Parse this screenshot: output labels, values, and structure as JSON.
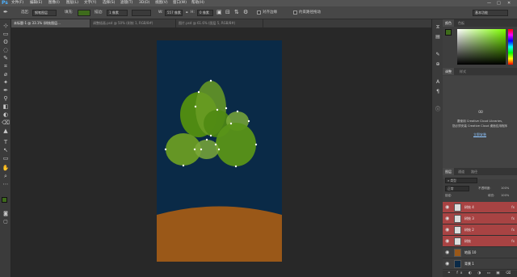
{
  "app": {
    "logo": "Ps",
    "menus": [
      "文件(F)",
      "编辑(E)",
      "图像(I)",
      "图层(L)",
      "文字(Y)",
      "选择(S)",
      "滤镜(T)",
      "3D(D)",
      "视图(V)",
      "窗口(W)",
      "帮助(H)"
    ],
    "window_controls": [
      "—",
      "□",
      "✕"
    ]
  },
  "options_bar": {
    "select_label": "选区:",
    "select_value": "钢笔图层",
    "fill_label": "填充:",
    "stroke_label": "描边:",
    "stroke_width": "1 像素",
    "w_label": "W:",
    "w_value": "557 像素",
    "h_label": "H:",
    "h_value": "0 像素",
    "align_edges_label": "对齐边缘",
    "constrain_label": "约束路径拖动",
    "workspace_value": "基本功能",
    "fill_color": "#3e6b1b"
  },
  "tabs": [
    "未标题-1 @ 33.1% (树枝图层...",
    "调整插画.psd @ 50% (树枝 1, RGB/8#)",
    "图片.psd @ 61.6% (图层 5, RGB/8#)"
  ],
  "toolbar": {
    "tools": [
      "⊹",
      "▭",
      "ʘ",
      "◌",
      "✎",
      "⌗",
      "⌀",
      "✦",
      "✒",
      "⚲",
      "◧",
      "◐",
      "⌫",
      "▲",
      "T",
      "↖",
      "▭",
      "✋",
      "⌕",
      "⋯"
    ],
    "fg_color": "#3e6b1b",
    "bg_color": "#ffffff"
  },
  "canvas": {
    "sky_color": "#0a2a47",
    "ground_color": "#9a5818",
    "leaf_color_dark": "#4f8a12",
    "leaf_color_light": "#7aa83a"
  },
  "right_panels": {
    "color_tabs": [
      "颜色",
      "色板"
    ],
    "adjust_tabs": [
      "调整",
      "样式"
    ],
    "cc_title": "库",
    "cc_text_1": "要使用 Creative Cloud Libraries,",
    "cc_text_2": "您必须安装 Creative Cloud 桌面应用程序",
    "cc_link": "立即安装",
    "layers_tabs": [
      "图层",
      "通道",
      "路径"
    ],
    "blend_mode": "正常",
    "opacity_label": "不透明度:",
    "opacity_value": "100%",
    "lock_label": "锁定:",
    "fill_label": "填充:",
    "fill_value": "100%",
    "layers": [
      {
        "name": "树枝 4",
        "fx": "fx"
      },
      {
        "name": "树枝 3",
        "fx": "fx"
      },
      {
        "name": "树枝 2",
        "fx": "fx"
      },
      {
        "name": "树枝",
        "fx": "fx"
      },
      {
        "name": "地面 10",
        "fx": ""
      },
      {
        "name": "背景 1",
        "fx": ""
      }
    ]
  }
}
